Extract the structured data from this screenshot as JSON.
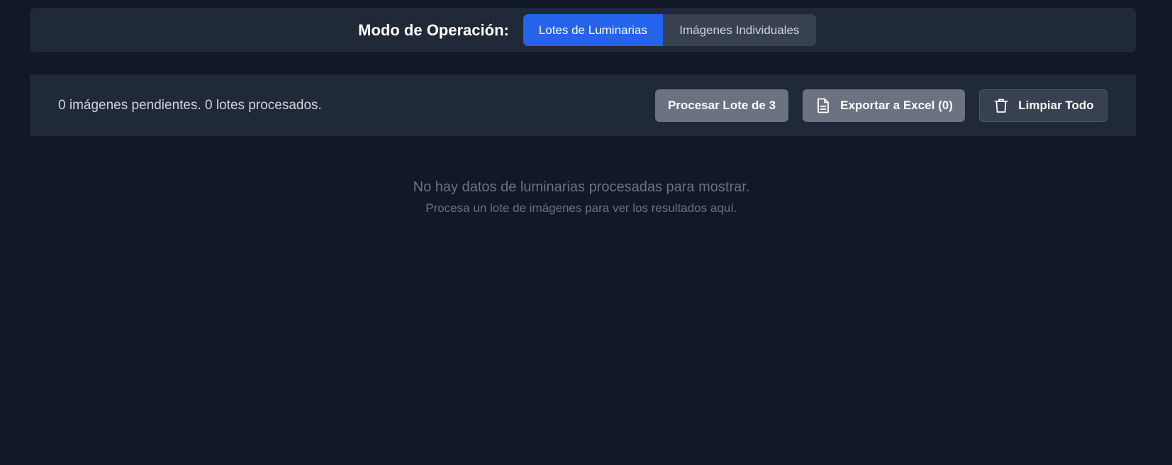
{
  "mode": {
    "title": "Modo de Operación:",
    "options": [
      {
        "label": "Lotes de Luminarias",
        "active": true
      },
      {
        "label": "Imágenes Individuales",
        "active": false
      }
    ]
  },
  "actions": {
    "status": "0 imágenes pendientes. 0 lotes procesados.",
    "process_label": "Procesar Lote de 3",
    "export_label": "Exportar a Excel (0)",
    "clear_label": "Limpiar Todo"
  },
  "empty_state": {
    "message": "No hay datos de luminarias procesadas para mostrar.",
    "hint": "Procesa un lote de imágenes para ver los resultados aquí."
  },
  "colors": {
    "background": "#111827",
    "panel": "#1f2937",
    "accent": "#2563eb"
  }
}
